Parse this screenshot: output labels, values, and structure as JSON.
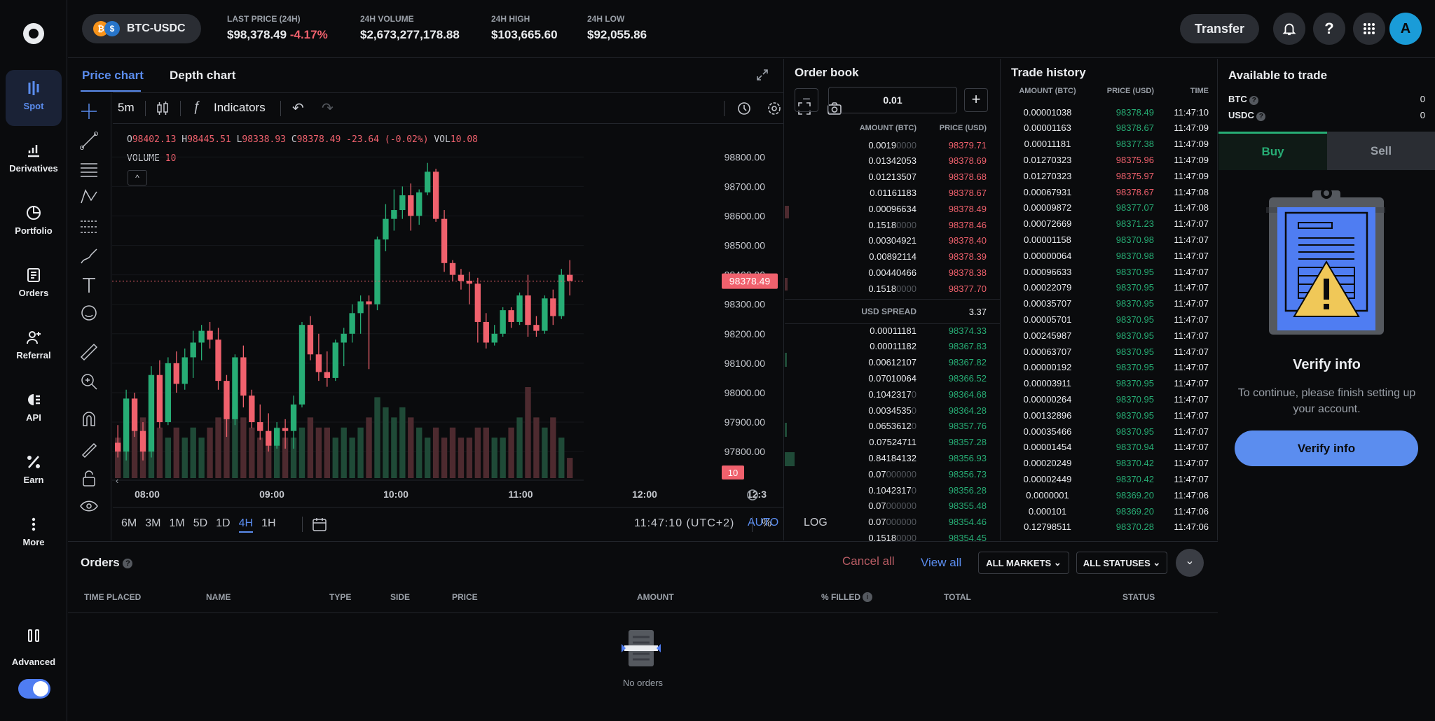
{
  "sidebar": {
    "items": [
      {
        "label": "Spot",
        "icon": "spot-icon",
        "active": true
      },
      {
        "label": "Derivatives",
        "icon": "derivatives-icon"
      },
      {
        "label": "Portfolio",
        "icon": "portfolio-icon"
      },
      {
        "label": "Orders",
        "icon": "orders-icon"
      },
      {
        "label": "Referral",
        "icon": "referral-icon"
      },
      {
        "label": "API",
        "icon": "api-icon"
      },
      {
        "label": "Earn",
        "icon": "earn-icon"
      },
      {
        "label": "More",
        "icon": "more-icon"
      }
    ],
    "advanced_label": "Advanced",
    "advanced_on": true
  },
  "header": {
    "pair": "BTC-USDC",
    "stats": [
      {
        "label": "LAST PRICE (24H)",
        "value": "$98,378.49",
        "change": "-4.17%"
      },
      {
        "label": "24H VOLUME",
        "value": "$2,673,277,178.88"
      },
      {
        "label": "24H HIGH",
        "value": "$103,665.60"
      },
      {
        "label": "24H LOW",
        "value": "$92,055.86"
      }
    ],
    "transfer_label": "Transfer",
    "avatar_initial": "A"
  },
  "chart_panel": {
    "tabs": [
      "Price chart",
      "Depth chart"
    ],
    "interval": "5m",
    "indicators_label": "Indicators",
    "ohlc": {
      "o": "98402.13",
      "h": "98445.51",
      "l": "98338.93",
      "c": "98378.49",
      "chg": "-23.64 (-0.02%)",
      "vol": "10.08"
    },
    "ohlc_labels": {
      "o": "O",
      "h": "H",
      "l": "L",
      "c": "C",
      "vol": "VOL"
    },
    "volume_label": "VOLUME",
    "volume_value": "10",
    "price_tag": "98378.49",
    "volume_tag": "10",
    "ranges": [
      "6M",
      "3M",
      "1M",
      "5D",
      "1D",
      "4H",
      "1H"
    ],
    "active_range": "4H",
    "clock": "11:47:10 (UTC+2)",
    "opts": [
      "%",
      "LOG",
      "AUTO"
    ]
  },
  "chart_data": {
    "type": "candlestick",
    "pair": "BTC-USDC",
    "interval": "5m",
    "y_ticks": [
      "98800.00",
      "98700.00",
      "98600.00",
      "98500.00",
      "98400.00",
      "98300.00",
      "98200.00",
      "98100.00",
      "98000.00",
      "97900.00",
      "97800.00"
    ],
    "x_ticks": [
      "08:00",
      "09:00",
      "10:00",
      "11:00",
      "12:00",
      "12:3"
    ],
    "ylim": [
      97710,
      98910
    ],
    "last_price": 98378.49,
    "candles": [
      [
        97830,
        97890,
        97780,
        97800
      ],
      [
        97800,
        98010,
        97770,
        97980
      ],
      [
        97980,
        98000,
        97850,
        97870
      ],
      [
        97870,
        97900,
        97770,
        97800
      ],
      [
        97800,
        98090,
        97780,
        98060
      ],
      [
        98060,
        98110,
        97880,
        97900
      ],
      [
        97900,
        98120,
        97890,
        98100
      ],
      [
        98100,
        98140,
        98000,
        98030
      ],
      [
        98030,
        98150,
        98010,
        98120
      ],
      [
        98120,
        98210,
        98050,
        98170
      ],
      [
        98170,
        98230,
        98110,
        98210
      ],
      [
        98210,
        98240,
        98150,
        98180
      ],
      [
        98180,
        98220,
        98010,
        98040
      ],
      [
        98040,
        98060,
        97850,
        97910
      ],
      [
        97910,
        98130,
        97890,
        98120
      ],
      [
        98120,
        98160,
        97950,
        97990
      ],
      [
        97990,
        98010,
        97880,
        97900
      ],
      [
        97900,
        97960,
        97840,
        97870
      ],
      [
        97870,
        97930,
        97800,
        97820
      ],
      [
        97820,
        97900,
        97810,
        97880
      ],
      [
        97880,
        97910,
        97810,
        97870
      ],
      [
        97870,
        97990,
        97810,
        97960
      ],
      [
        97960,
        98240,
        97950,
        98230
      ],
      [
        98230,
        98260,
        98110,
        98130
      ],
      [
        98130,
        98200,
        98040,
        98070
      ],
      [
        98070,
        98140,
        98020,
        98050
      ],
      [
        98050,
        98180,
        98040,
        98170
      ],
      [
        98170,
        98220,
        98090,
        98200
      ],
      [
        98200,
        98300,
        98170,
        98270
      ],
      [
        98270,
        98330,
        98200,
        98310
      ],
      [
        98310,
        98330,
        98080,
        98300
      ],
      [
        98300,
        98530,
        98280,
        98520
      ],
      [
        98520,
        98640,
        98480,
        98590
      ],
      [
        98590,
        98690,
        98550,
        98620
      ],
      [
        98620,
        98700,
        98590,
        98670
      ],
      [
        98670,
        98710,
        98550,
        98600
      ],
      [
        98600,
        98690,
        98570,
        98680
      ],
      [
        98680,
        98780,
        98670,
        98750
      ],
      [
        98750,
        98760,
        98580,
        98590
      ],
      [
        98590,
        98620,
        98410,
        98440
      ],
      [
        98440,
        98450,
        98380,
        98400
      ],
      [
        98400,
        98420,
        98350,
        98380
      ],
      [
        98380,
        98410,
        98300,
        98370
      ],
      [
        98370,
        98390,
        98170,
        98240
      ],
      [
        98240,
        98270,
        98150,
        98170
      ],
      [
        98170,
        98230,
        98160,
        98200
      ],
      [
        98200,
        98290,
        98190,
        98280
      ],
      [
        98280,
        98290,
        98220,
        98240
      ],
      [
        98240,
        98340,
        98230,
        98330
      ],
      [
        98330,
        98400,
        98190,
        98230
      ],
      [
        98230,
        98260,
        98190,
        98210
      ],
      [
        98210,
        98330,
        98200,
        98320
      ],
      [
        98320,
        98350,
        98230,
        98260
      ],
      [
        98260,
        98420,
        98250,
        98400
      ],
      [
        98400,
        98450,
        98330,
        98380
      ]
    ],
    "volumes": [
      4,
      7,
      5,
      6,
      4,
      5,
      4,
      5,
      4,
      5,
      4,
      5,
      6,
      8,
      7,
      6,
      5,
      4,
      4,
      5,
      4,
      4,
      5,
      6,
      5,
      5,
      4,
      5,
      4,
      5,
      6,
      8,
      7,
      6,
      7,
      6,
      5,
      4,
      5,
      4,
      5,
      4,
      4,
      5,
      5,
      4,
      4,
      5,
      6,
      9,
      6,
      5,
      6,
      4,
      2
    ]
  },
  "order_book": {
    "title": "Order book",
    "step": "0.01",
    "col_amount": "AMOUNT (BTC)",
    "col_price": "PRICE (USD)",
    "asks": [
      {
        "amt": "0.0019",
        "dim": "0000",
        "price": "98379.71"
      },
      {
        "amt": "0.01342053",
        "dim": "",
        "price": "98378.69"
      },
      {
        "amt": "0.01213507",
        "dim": "",
        "price": "98378.68"
      },
      {
        "amt": "0.01161183",
        "dim": "",
        "price": "98378.67"
      },
      {
        "amt": "0.00096634",
        "dim": "",
        "price": "98378.49"
      },
      {
        "amt": "0.1518",
        "dim": "0000",
        "price": "98378.46"
      },
      {
        "amt": "0.00304921",
        "dim": "",
        "price": "98378.40"
      },
      {
        "amt": "0.00892114",
        "dim": "",
        "price": "98378.39"
      },
      {
        "amt": "0.00440466",
        "dim": "",
        "price": "98378.38"
      },
      {
        "amt": "0.1518",
        "dim": "0000",
        "price": "98377.70"
      }
    ],
    "spread_label": "USD SPREAD",
    "spread": "3.37",
    "bids": [
      {
        "amt": "0.00011181",
        "dim": "",
        "price": "98374.33"
      },
      {
        "amt": "0.00011182",
        "dim": "",
        "price": "98367.83"
      },
      {
        "amt": "0.00612107",
        "dim": "",
        "price": "98367.82"
      },
      {
        "amt": "0.07010064",
        "dim": "",
        "price": "98366.52"
      },
      {
        "amt": "0.1042317",
        "dim": "0",
        "price": "98364.68"
      },
      {
        "amt": "0.0034535",
        "dim": "0",
        "price": "98364.28"
      },
      {
        "amt": "0.0653612",
        "dim": "0",
        "price": "98357.76"
      },
      {
        "amt": "0.07524711",
        "dim": "",
        "price": "98357.28"
      },
      {
        "amt": "0.84184132",
        "dim": "",
        "price": "98356.93"
      },
      {
        "amt": "0.07",
        "dim": "000000",
        "price": "98356.73"
      },
      {
        "amt": "0.1042317",
        "dim": "0",
        "price": "98356.28"
      },
      {
        "amt": "0.07",
        "dim": "000000",
        "price": "98355.48"
      },
      {
        "amt": "0.07",
        "dim": "000000",
        "price": "98354.46"
      },
      {
        "amt": "0.1518",
        "dim": "0000",
        "price": "98354.45"
      }
    ]
  },
  "trade_history": {
    "title": "Trade history",
    "cols": [
      "AMOUNT (BTC)",
      "PRICE (USD)",
      "TIME"
    ],
    "rows": [
      {
        "amt": "0.00001038",
        "price": "98378.49",
        "side": "buy",
        "time": "11:47:10"
      },
      {
        "amt": "0.00001163",
        "price": "98378.67",
        "side": "buy",
        "time": "11:47:09"
      },
      {
        "amt": "0.00011181",
        "price": "98377.38",
        "side": "buy",
        "time": "11:47:09"
      },
      {
        "amt": "0.01270323",
        "price": "98375.96",
        "side": "sell",
        "time": "11:47:09"
      },
      {
        "amt": "0.01270323",
        "price": "98375.97",
        "side": "sell",
        "time": "11:47:09"
      },
      {
        "amt": "0.00067931",
        "price": "98378.67",
        "side": "sell",
        "time": "11:47:08"
      },
      {
        "amt": "0.00009872",
        "price": "98377.07",
        "side": "buy",
        "time": "11:47:08"
      },
      {
        "amt": "0.00072669",
        "price": "98371.23",
        "side": "buy",
        "time": "11:47:07"
      },
      {
        "amt": "0.00001158",
        "price": "98370.98",
        "side": "buy",
        "time": "11:47:07"
      },
      {
        "amt": "0.00000064",
        "price": "98370.98",
        "side": "buy",
        "time": "11:47:07"
      },
      {
        "amt": "0.00096633",
        "price": "98370.95",
        "side": "buy",
        "time": "11:47:07"
      },
      {
        "amt": "0.00022079",
        "price": "98370.95",
        "side": "buy",
        "time": "11:47:07"
      },
      {
        "amt": "0.00035707",
        "price": "98370.95",
        "side": "buy",
        "time": "11:47:07"
      },
      {
        "amt": "0.00005701",
        "price": "98370.95",
        "side": "buy",
        "time": "11:47:07"
      },
      {
        "amt": "0.00245987",
        "price": "98370.95",
        "side": "buy",
        "time": "11:47:07"
      },
      {
        "amt": "0.00063707",
        "price": "98370.95",
        "side": "buy",
        "time": "11:47:07"
      },
      {
        "amt": "0.00000192",
        "price": "98370.95",
        "side": "buy",
        "time": "11:47:07"
      },
      {
        "amt": "0.00003911",
        "price": "98370.95",
        "side": "buy",
        "time": "11:47:07"
      },
      {
        "amt": "0.00000264",
        "price": "98370.95",
        "side": "buy",
        "time": "11:47:07"
      },
      {
        "amt": "0.00132896",
        "price": "98370.95",
        "side": "buy",
        "time": "11:47:07"
      },
      {
        "amt": "0.00035466",
        "price": "98370.95",
        "side": "buy",
        "time": "11:47:07"
      },
      {
        "amt": "0.00001454",
        "price": "98370.94",
        "side": "buy",
        "time": "11:47:07"
      },
      {
        "amt": "0.00020249",
        "price": "98370.42",
        "side": "buy",
        "time": "11:47:07"
      },
      {
        "amt": "0.00002449",
        "price": "98370.42",
        "side": "buy",
        "time": "11:47:07"
      },
      {
        "amt": "0.0000001",
        "price": "98369.20",
        "side": "buy",
        "time": "11:47:06"
      },
      {
        "amt": "0.000101",
        "price": "98369.20",
        "side": "buy",
        "time": "11:47:06"
      },
      {
        "amt": "0.12798511",
        "price": "98370.28",
        "side": "buy",
        "time": "11:47:06"
      }
    ]
  },
  "available": {
    "title": "Available to trade",
    "assets": [
      {
        "name": "BTC",
        "value": "0"
      },
      {
        "name": "USDC",
        "value": "0"
      }
    ],
    "buy_label": "Buy",
    "sell_label": "Sell",
    "verify_title": "Verify info",
    "verify_text": "To continue, please finish setting up your account.",
    "verify_btn": "Verify info"
  },
  "orders": {
    "title": "Orders",
    "cancel_all": "Cancel all",
    "view_all": "View all",
    "markets_filter": "ALL MARKETS",
    "status_filter": "ALL STATUSES",
    "cols": [
      "TIME PLACED",
      "NAME",
      "TYPE",
      "SIDE",
      "PRICE",
      "AMOUNT",
      "% FILLED",
      "TOTAL",
      "STATUS"
    ],
    "empty": "No orders"
  },
  "colors": {
    "accent": "#5b8def",
    "up": "#27ad75",
    "down": "#f0616d",
    "bg": "#0a0b0d",
    "panel": "#2a2d33"
  }
}
